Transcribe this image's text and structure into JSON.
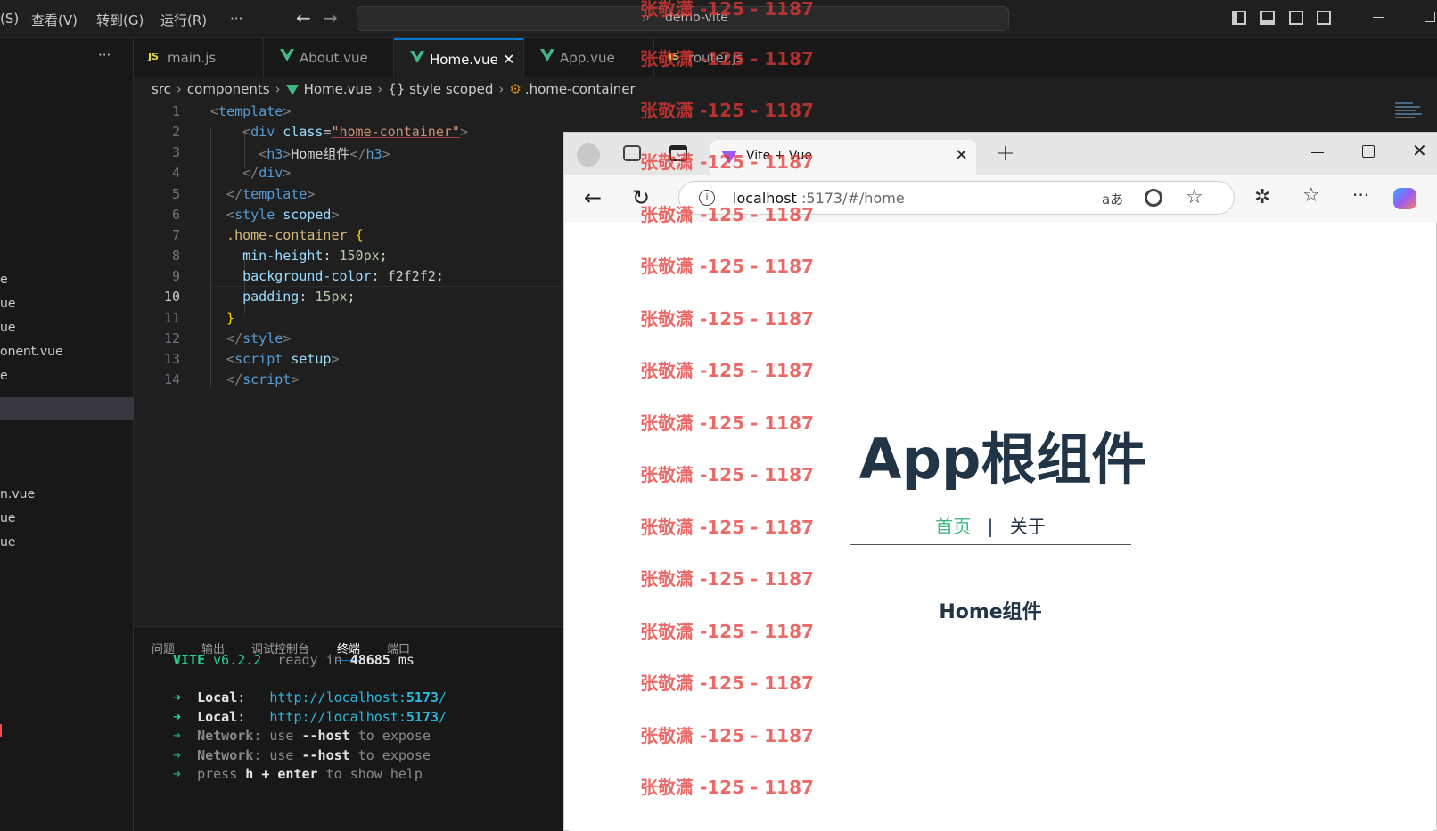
{
  "menus": [
    "(S)",
    "查看(V)",
    "转到(G)",
    "运行(R)",
    "···"
  ],
  "command_center": "demo-vite",
  "sidebar": {
    "more": "···",
    "items": [
      "e",
      "ue",
      "ue",
      "onent.vue",
      "e",
      "n.vue",
      "ue",
      "ue"
    ]
  },
  "tabs": [
    {
      "label": "main.js",
      "icon": "js"
    },
    {
      "label": "About.vue",
      "icon": "vue"
    },
    {
      "label": "Home.vue",
      "icon": "vue",
      "active": true
    },
    {
      "label": "App.vue",
      "icon": "vue"
    },
    {
      "label": "router.js",
      "icon": "js"
    }
  ],
  "breadcrumb": [
    "src",
    "components",
    "Home.vue",
    "{} style scoped",
    ".home-container"
  ],
  "code": [
    [
      {
        "t": "<",
        "c": "#808080"
      },
      {
        "t": "template",
        "c": "#569cd6"
      },
      {
        "t": ">",
        "c": "#808080"
      }
    ],
    [
      {
        "t": "    <",
        "c": "#808080"
      },
      {
        "t": "div ",
        "c": "#569cd6"
      },
      {
        "t": "class",
        "c": "#9cdcfe"
      },
      {
        "t": "=",
        "c": "#d4d4d4"
      },
      {
        "t": "\"home-container\"",
        "c": "#ce9178"
      },
      {
        "t": ">",
        "c": "#808080"
      }
    ],
    [
      {
        "t": "      <",
        "c": "#808080"
      },
      {
        "t": "h3",
        "c": "#569cd6"
      },
      {
        "t": ">",
        "c": "#808080"
      },
      {
        "t": "Home组件",
        "c": "#d4d4d4"
      },
      {
        "t": "</",
        "c": "#808080"
      },
      {
        "t": "h3",
        "c": "#569cd6"
      },
      {
        "t": ">",
        "c": "#808080"
      }
    ],
    [
      {
        "t": "    </",
        "c": "#808080"
      },
      {
        "t": "div",
        "c": "#569cd6"
      },
      {
        "t": ">",
        "c": "#808080"
      }
    ],
    [
      {
        "t": "  </",
        "c": "#808080"
      },
      {
        "t": "template",
        "c": "#569cd6"
      },
      {
        "t": ">",
        "c": "#808080"
      }
    ],
    [
      {
        "t": "  <",
        "c": "#808080"
      },
      {
        "t": "style ",
        "c": "#569cd6"
      },
      {
        "t": "scoped",
        "c": "#9cdcfe"
      },
      {
        "t": ">",
        "c": "#808080"
      }
    ],
    [
      {
        "t": "  .home-container ",
        "c": "#d7ba7d"
      },
      {
        "t": "{",
        "c": "#ffd700"
      }
    ],
    [
      {
        "t": "    min-height",
        "c": "#9cdcfe"
      },
      {
        "t": ": ",
        "c": "#d4d4d4"
      },
      {
        "t": "150px",
        "c": "#b5cea8"
      },
      {
        "t": ";",
        "c": "#d4d4d4"
      }
    ],
    [
      {
        "t": "    background-color",
        "c": "#9cdcfe"
      },
      {
        "t": ": f2f2f2;",
        "c": "#d4d4d4"
      }
    ],
    [
      {
        "t": "    padding",
        "c": "#9cdcfe"
      },
      {
        "t": ": ",
        "c": "#d4d4d4"
      },
      {
        "t": "15px",
        "c": "#b5cea8"
      },
      {
        "t": ";",
        "c": "#d4d4d4"
      }
    ],
    [
      {
        "t": "  }",
        "c": "#ffd700"
      }
    ],
    [
      {
        "t": "  </",
        "c": "#808080"
      },
      {
        "t": "style",
        "c": "#569cd6"
      },
      {
        "t": ">",
        "c": "#808080"
      }
    ],
    [
      {
        "t": "  <",
        "c": "#808080"
      },
      {
        "t": "script ",
        "c": "#569cd6"
      },
      {
        "t": "setup",
        "c": "#9cdcfe"
      },
      {
        "t": ">",
        "c": "#808080"
      }
    ],
    [
      {
        "t": "  </",
        "c": "#808080"
      },
      {
        "t": "script",
        "c": "#569cd6"
      },
      {
        "t": ">",
        "c": "#808080"
      }
    ]
  ],
  "panel_tabs": [
    "问题",
    "输出",
    "调试控制台",
    "终端",
    "端口"
  ],
  "terminal": [
    [
      {
        "t": "VITE ",
        "c": "#23d18b",
        "b": true
      },
      {
        "t": "v6.2.2",
        "c": "#23d18b"
      },
      {
        "t": "  ready in ",
        "c": "#8a8a8a"
      },
      {
        "t": "48685",
        "c": "#e5e5e5",
        "b": true
      },
      {
        "t": " ms",
        "c": "#e5e5e5"
      }
    ],
    [],
    [
      {
        "t": "➜  ",
        "c": "#23d18b"
      },
      {
        "t": "Local",
        "c": "#e5e5e5",
        "b": true
      },
      {
        "t": ":   ",
        "c": "#e5e5e5"
      },
      {
        "t": "http://localhost:",
        "c": "#29b8db"
      },
      {
        "t": "5173",
        "c": "#29b8db",
        "b": true
      },
      {
        "t": "/",
        "c": "#29b8db"
      }
    ],
    [
      {
        "t": "➜  ",
        "c": "#23d18b"
      },
      {
        "t": "Local",
        "c": "#e5e5e5",
        "b": true
      },
      {
        "t": ":   ",
        "c": "#e5e5e5"
      },
      {
        "t": "http://localhost:",
        "c": "#29b8db"
      },
      {
        "t": "5173",
        "c": "#29b8db",
        "b": true
      },
      {
        "t": "/",
        "c": "#29b8db"
      }
    ],
    [
      {
        "t": "➜  ",
        "c": "#1a9e68"
      },
      {
        "t": "Network",
        "c": "#8a8a8a",
        "b": true
      },
      {
        "t": ": use ",
        "c": "#8a8a8a"
      },
      {
        "t": "--host",
        "c": "#e5e5e5",
        "b": true
      },
      {
        "t": " to expose",
        "c": "#8a8a8a"
      }
    ],
    [
      {
        "t": "➜  ",
        "c": "#1a9e68"
      },
      {
        "t": "Network",
        "c": "#8a8a8a",
        "b": true
      },
      {
        "t": ": use ",
        "c": "#8a8a8a"
      },
      {
        "t": "--host",
        "c": "#e5e5e5",
        "b": true
      },
      {
        "t": " to expose",
        "c": "#8a8a8a"
      }
    ],
    [
      {
        "t": "➜  ",
        "c": "#1a9e68"
      },
      {
        "t": "press ",
        "c": "#8a8a8a"
      },
      {
        "t": "h + enter",
        "c": "#e5e5e5",
        "b": true
      },
      {
        "t": " to show help",
        "c": "#8a8a8a"
      }
    ]
  ],
  "browser": {
    "tab_title": "Vite + Vue",
    "address_host": "localhost",
    "address_rest": ":5173/#/home",
    "page_title": "App根组件",
    "nav_home": "首页",
    "nav_sep": "|",
    "nav_about": "关于",
    "content": "Home组件"
  },
  "watermark": "张敬潇 -125 - 1187"
}
